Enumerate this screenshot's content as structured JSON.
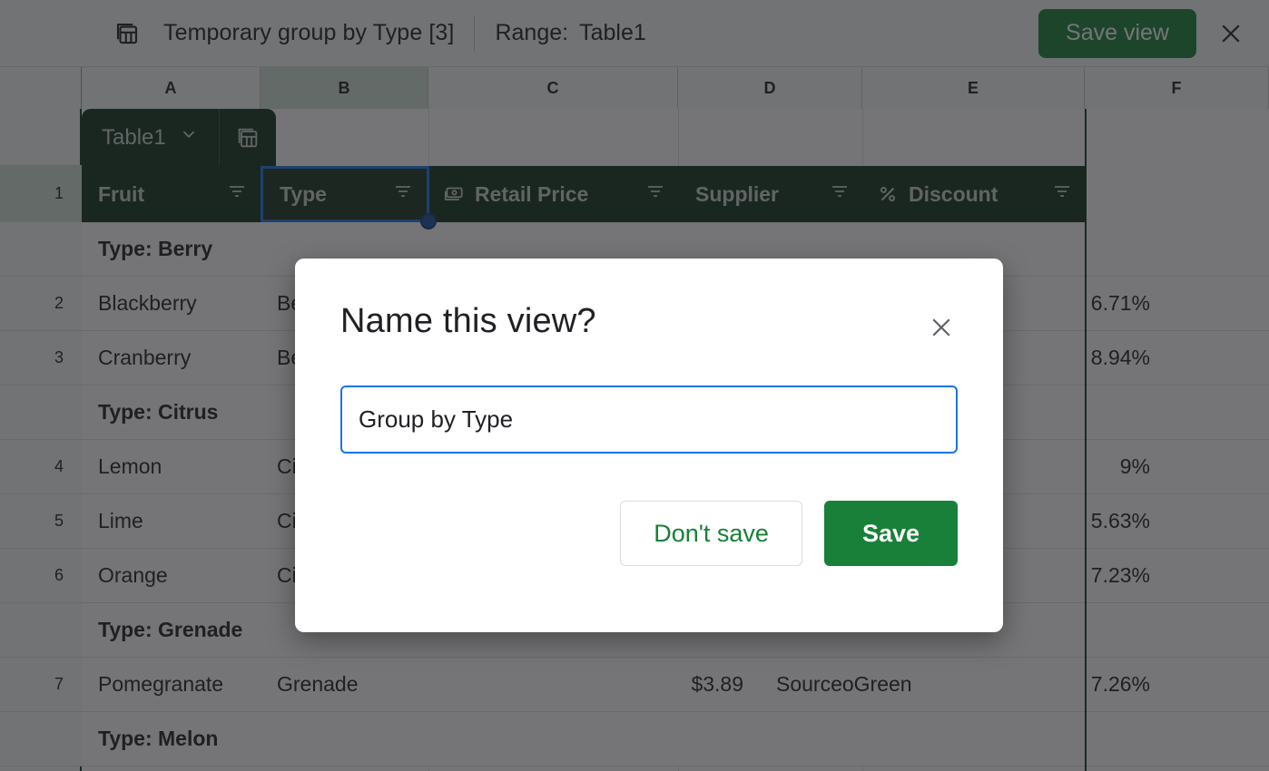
{
  "toolbar": {
    "icon": "table-grid-icon",
    "title": "Temporary group by Type [3]",
    "range_label": "Range:",
    "range_value": "Table1",
    "save_view_label": "Save view",
    "close_icon": "close-icon"
  },
  "grid": {
    "column_letters": [
      "A",
      "B",
      "C",
      "D",
      "E",
      "F"
    ],
    "selected_column": "B",
    "row_numbers": [
      "1",
      "2",
      "3",
      "4",
      "5",
      "6",
      "7"
    ],
    "selected_row": "1"
  },
  "table": {
    "tab_name": "Table1",
    "tab_chevron_icon": "chevron-down-icon",
    "tab_table_icon": "table-grid-icon",
    "headers": [
      {
        "label": "Fruit",
        "icon": null,
        "filter_icon": "filter-icon",
        "active": false
      },
      {
        "label": "Type",
        "icon": null,
        "filter_icon": "filter-icon",
        "active": true
      },
      {
        "label": "Retail Price",
        "icon": "money-icon",
        "filter_icon": "filter-icon",
        "active": false
      },
      {
        "label": "Supplier",
        "icon": null,
        "filter_icon": "filter-icon",
        "active": false
      },
      {
        "label": "Discount",
        "icon": "percent-icon",
        "filter_icon": "filter-icon",
        "active": false
      }
    ],
    "rows": [
      {
        "kind": "group",
        "rownum": "",
        "label": "Type: Berry"
      },
      {
        "kind": "data",
        "rownum": "2",
        "fruit": "Blackberry",
        "type": "Berry",
        "price": "",
        "supplier": "",
        "discount": "6.71%"
      },
      {
        "kind": "data",
        "rownum": "3",
        "fruit": "Cranberry",
        "type": "Berry",
        "price": "",
        "supplier": "",
        "discount": "8.94%"
      },
      {
        "kind": "group",
        "rownum": "",
        "label": "Type: Citrus"
      },
      {
        "kind": "data",
        "rownum": "4",
        "fruit": "Lemon",
        "type": "Citrus",
        "price": "",
        "supplier": "",
        "discount": "9%"
      },
      {
        "kind": "data",
        "rownum": "5",
        "fruit": "Lime",
        "type": "Citrus",
        "price": "",
        "supplier": "",
        "discount": "5.63%"
      },
      {
        "kind": "data",
        "rownum": "6",
        "fruit": "Orange",
        "type": "Citrus",
        "price": "",
        "supplier": "",
        "discount": "7.23%"
      },
      {
        "kind": "group",
        "rownum": "",
        "label": "Type: Grenade"
      },
      {
        "kind": "data",
        "rownum": "7",
        "fruit": "Pomegranate",
        "type": "Grenade",
        "price": "$3.89",
        "supplier": "SourceoGreen",
        "discount": "7.26%"
      },
      {
        "kind": "group",
        "rownum": "",
        "label": "Type: Melon"
      }
    ]
  },
  "modal": {
    "title": "Name this view?",
    "close_icon": "close-icon",
    "input_value": "Group by Type",
    "input_placeholder": "",
    "dont_save_label": "Don't save",
    "save_label": "Save"
  },
  "colors": {
    "accent_green": "#188038",
    "table_green": "#11331f",
    "focus_blue": "#1a73e8",
    "scrim": "rgba(32,33,36,0.62)"
  }
}
